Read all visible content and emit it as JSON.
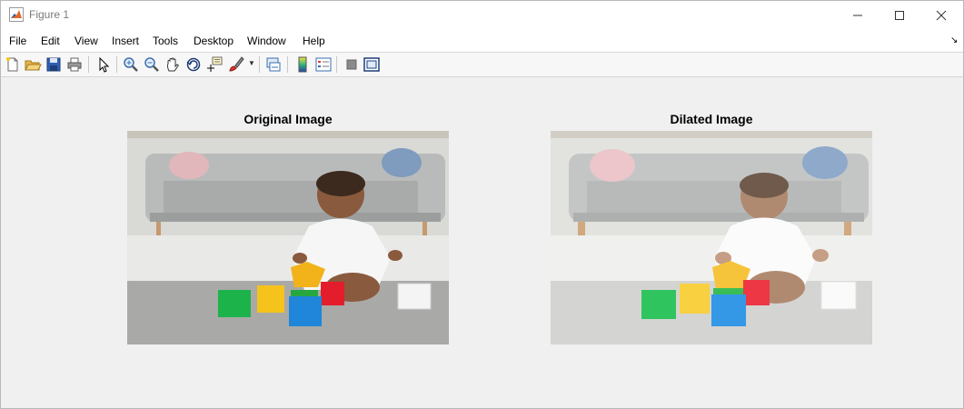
{
  "window": {
    "title": "Figure 1"
  },
  "menu": {
    "items": [
      "File",
      "Edit",
      "View",
      "Insert",
      "Tools",
      "Desktop",
      "Window",
      "Help"
    ]
  },
  "toolbar": {
    "buttons": [
      {
        "icon": "new-figure-icon"
      },
      {
        "icon": "open-file-icon"
      },
      {
        "icon": "save-icon"
      },
      {
        "icon": "print-icon"
      },
      {
        "icon": "pointer-icon"
      },
      {
        "icon": "zoom-in-icon"
      },
      {
        "icon": "zoom-out-icon"
      },
      {
        "icon": "pan-icon"
      },
      {
        "icon": "rotate-3d-icon"
      },
      {
        "icon": "data-cursor-icon"
      },
      {
        "icon": "brush-icon"
      },
      {
        "icon": "link-plot-icon"
      },
      {
        "icon": "colorbar-icon"
      },
      {
        "icon": "legend-icon"
      },
      {
        "icon": "hide-plot-tools-icon"
      },
      {
        "icon": "show-plot-tools-icon"
      }
    ]
  },
  "axes": [
    {
      "title": "Original Image"
    },
    {
      "title": "Dilated Image"
    }
  ],
  "colors": {
    "background": "#f0f0f0",
    "titlebar": "#ffffff"
  }
}
